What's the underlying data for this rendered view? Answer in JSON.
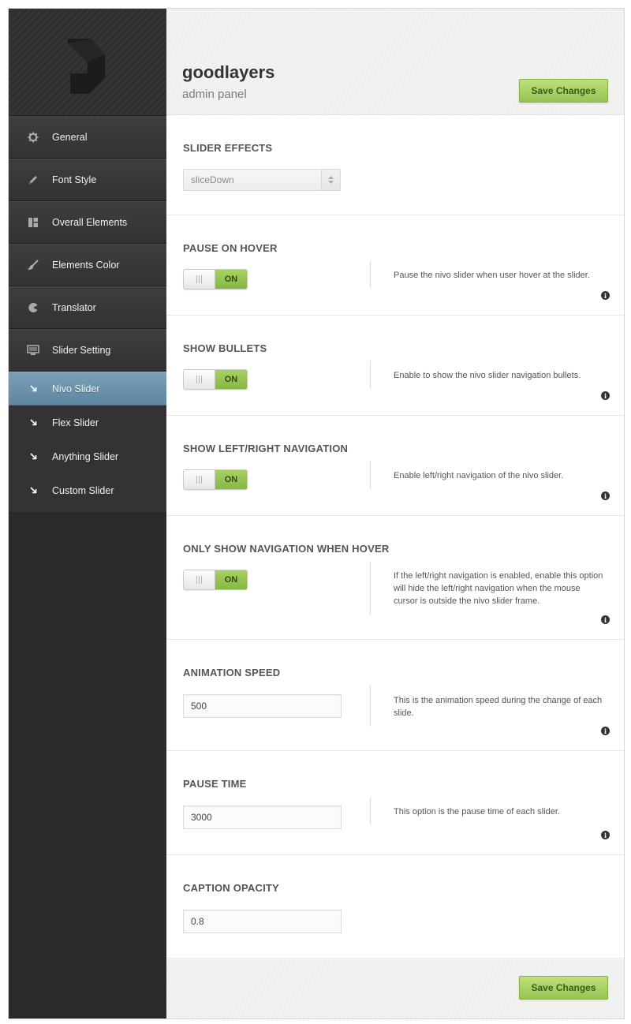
{
  "brand": {
    "name": "goodlayers",
    "subtitle": "admin panel"
  },
  "buttons": {
    "save_label": "Save Changes"
  },
  "sidebar": {
    "items": [
      {
        "label": "General",
        "icon": "gear-icon"
      },
      {
        "label": "Font Style",
        "icon": "pencil-icon"
      },
      {
        "label": "Overall Elements",
        "icon": "layout-icon"
      },
      {
        "label": "Elements Color",
        "icon": "brush-icon"
      },
      {
        "label": "Translator",
        "icon": "pacman-icon"
      },
      {
        "label": "Slider Setting",
        "icon": "monitor-icon"
      }
    ],
    "subitems": [
      {
        "label": "Nivo Slider",
        "active": true
      },
      {
        "label": "Flex Slider"
      },
      {
        "label": "Anything Slider"
      },
      {
        "label": "Custom Slider"
      }
    ]
  },
  "sections": {
    "slider_effects": {
      "title": "SLIDER EFFECTS",
      "value": "sliceDown"
    },
    "pause_on_hover": {
      "title": "PAUSE ON HOVER",
      "toggle": "ON",
      "desc": "Pause the nivo slider when user hover at the slider."
    },
    "show_bullets": {
      "title": "SHOW BULLETS",
      "toggle": "ON",
      "desc": "Enable to show the nivo slider navigation bullets."
    },
    "show_nav": {
      "title": "SHOW LEFT/RIGHT NAVIGATION",
      "toggle": "ON",
      "desc": "Enable left/right navigation of the nivo slider."
    },
    "nav_hover": {
      "title": "ONLY SHOW NAVIGATION WHEN HOVER",
      "toggle": "ON",
      "desc": "If the left/right navigation is enabled, enable this option will hide the left/right navigation when the mouse cursor is outside the nivo slider frame."
    },
    "animation_speed": {
      "title": "ANIMATION SPEED",
      "value": "500",
      "desc": "This is the animation speed during the change of each slide."
    },
    "pause_time": {
      "title": "PAUSE TIME",
      "value": "3000",
      "desc": "This option is the pause time of each slider."
    },
    "caption_opacity": {
      "title": "CAPTION OPACITY",
      "value": "0.8"
    }
  },
  "info_glyph": "i",
  "colors": {
    "accent_green": "#98c454",
    "active_blue": "#6b93ad",
    "sidebar_dark": "#2a2a2a"
  }
}
